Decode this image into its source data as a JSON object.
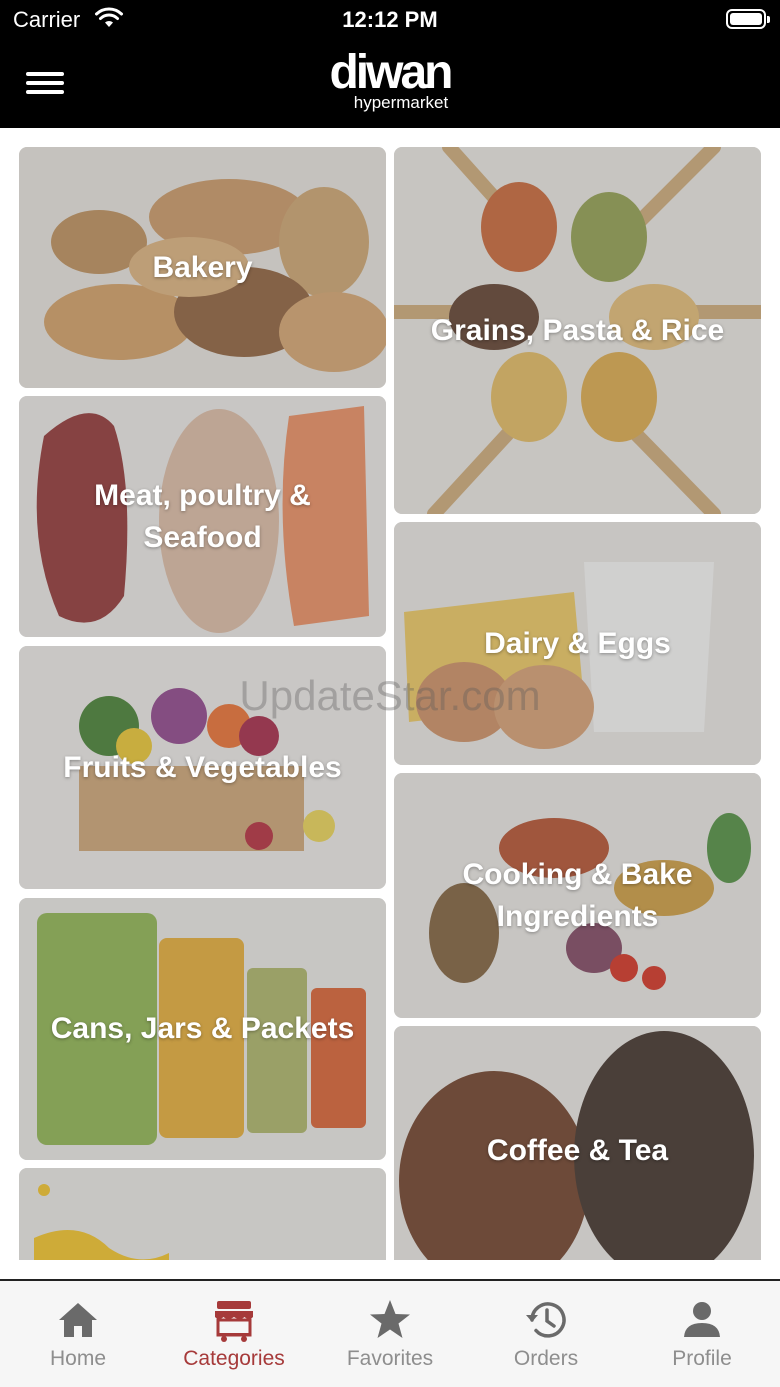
{
  "status_bar": {
    "carrier": "Carrier",
    "time": "12:12 PM"
  },
  "header": {
    "menu_icon": "hamburger-menu-icon",
    "logo_main": "diwan",
    "logo_sub": "hypermarket"
  },
  "categories": [
    {
      "label": "Bakery"
    },
    {
      "label": "Grains, Pasta & Rice"
    },
    {
      "label": "Meat, poultry & Seafood"
    },
    {
      "label": "Dairy & Eggs"
    },
    {
      "label": "Fruits & Vegetables"
    },
    {
      "label": "Cooking & Bake Ingredients"
    },
    {
      "label": "Cans, Jars & Packets"
    },
    {
      "label": "Coffee & Tea"
    },
    {
      "label": ""
    }
  ],
  "watermark": "UpdateStar.com",
  "tabs": [
    {
      "label": "Home",
      "icon": "home-icon"
    },
    {
      "label": "Categories",
      "icon": "store-icon",
      "active": true
    },
    {
      "label": "Favorites",
      "icon": "star-icon"
    },
    {
      "label": "Orders",
      "icon": "history-icon"
    },
    {
      "label": "Profile",
      "icon": "person-icon"
    }
  ],
  "colors": {
    "active_tab": "#a63a3a",
    "inactive_tab": "#8e8e8e",
    "header_bg": "#000000"
  }
}
